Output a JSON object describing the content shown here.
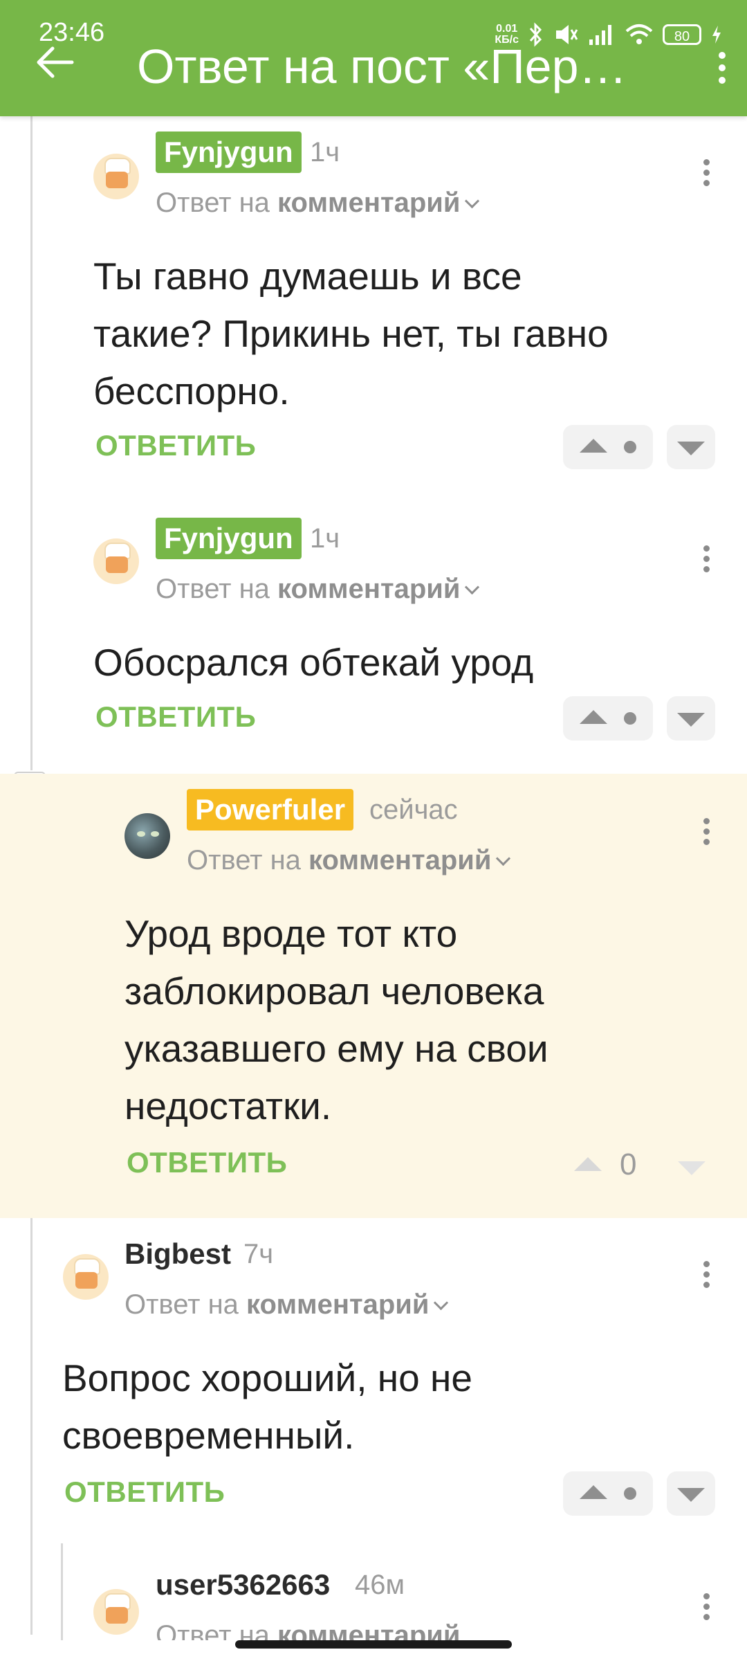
{
  "status": {
    "time": "23:46",
    "netspeed": "0.01\nКБ/с",
    "battery": "80"
  },
  "header": {
    "title": "Ответ на пост «Пер…"
  },
  "comments": [
    {
      "author": "Fynjygun",
      "time": "1ч",
      "reply_prefix": "Ответ на",
      "reply_target": "комментарий",
      "lines": [
        "Ты гавно думаешь и все",
        "такие? Прикинь нет, ты гавно",
        "бесспорно."
      ],
      "reply_label": "ОТВЕТИТЬ"
    },
    {
      "author": "Fynjygun",
      "time": "1ч",
      "reply_prefix": "Ответ на",
      "reply_target": "комментарий",
      "lines": [
        "Обосрался обтекай урод"
      ],
      "reply_label": "ОТВЕТИТЬ"
    },
    {
      "author": "Powerfuler",
      "time": "сейчас",
      "reply_prefix": "Ответ на",
      "reply_target": "комментарий",
      "lines": [
        "Урод вроде тот кто",
        "заблокировал человека",
        "указавшего ему на свои",
        "недостатки."
      ],
      "reply_label": "ОТВЕТИТЬ",
      "score": "0"
    },
    {
      "author": "Bigbest",
      "time": "7ч",
      "reply_prefix": "Ответ на",
      "reply_target": "комментарий",
      "lines": [
        "Вопрос хороший, но не",
        "своевременный."
      ],
      "reply_label": "ОТВЕТИТЬ"
    },
    {
      "author": "user5362663",
      "time": "46м",
      "reply_prefix": "Ответ на",
      "reply_target": "комментарий"
    }
  ],
  "colors": {
    "accent": "#77b748",
    "highlight": "#fdf7e5",
    "author_badge_yellow": "#f7bb21"
  }
}
